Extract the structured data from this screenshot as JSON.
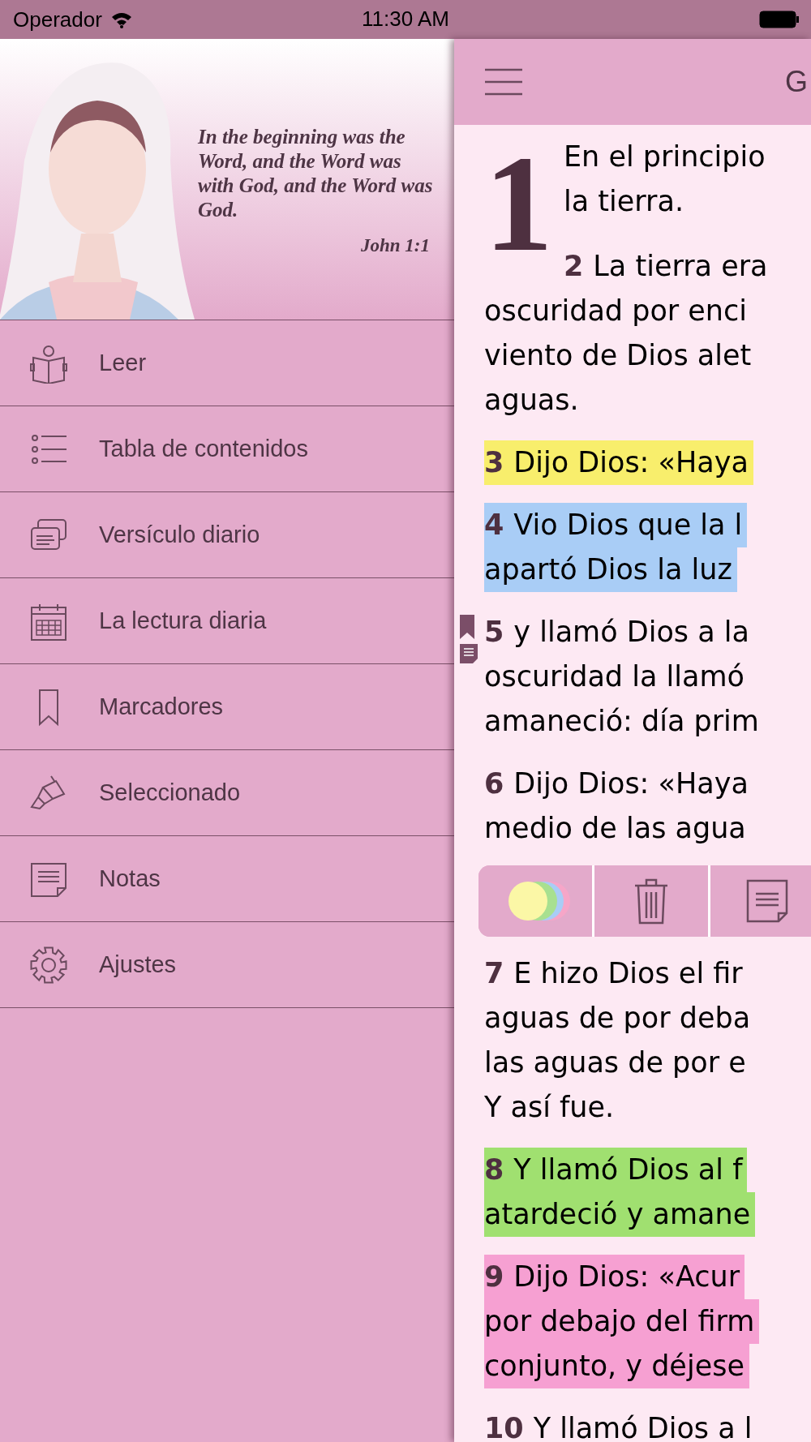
{
  "status_bar": {
    "carrier": "Operador",
    "time": "11:30 AM"
  },
  "drawer": {
    "header": {
      "kind": "picture",
      "quote": "In the beginning was the Word, and the Word was with God, and the Word was God.",
      "reference": "John 1:1"
    },
    "items": [
      {
        "kind": "read",
        "label": "Leer"
      },
      {
        "kind": "list",
        "label": "Tabla de contenidos"
      },
      {
        "kind": "cards",
        "label": "Versículo diario"
      },
      {
        "kind": "calendar",
        "label": "La lectura diaria"
      },
      {
        "kind": "bookmark",
        "label": "Marcadores"
      },
      {
        "kind": "highlighter",
        "label": "Seleccionado"
      },
      {
        "kind": "note",
        "label": "Notas"
      },
      {
        "kind": "gear",
        "label": "Ajustes"
      }
    ]
  },
  "reader": {
    "title": "G",
    "chapter": {
      "number": "1",
      "lines": [
        "En el principio",
        "la tierra."
      ]
    },
    "verses": [
      {
        "number": "2",
        "lines": [
          "La tierra era",
          "oscuridad por enci",
          "viento de Dios alet",
          "aguas."
        ],
        "bookmarked": false,
        "noted": false
      },
      {
        "number": "3",
        "lines": [
          "Dijo Dios: «Haya"
        ],
        "color": "#f8ee6c",
        "bookmarked": false,
        "noted": false
      },
      {
        "number": "4",
        "lines": [
          "Vio Dios que la l",
          "apartó Dios la luz"
        ],
        "color": "#a9cdf6",
        "bookmarked": false,
        "noted": false
      },
      {
        "number": "5",
        "lines": [
          "y llamó Dios a la",
          "oscuridad la llamó",
          "amaneció: día prim"
        ],
        "bookmarked": true,
        "noted": true
      },
      {
        "number": "6",
        "lines": [
          "Dijo Dios: «Haya",
          "medio de las agua"
        ],
        "bookmarked": false,
        "noted": false,
        "action_bar": {
          "buttons": [
            {
              "kind": "colors"
            },
            {
              "kind": "delete"
            },
            {
              "kind": "note"
            }
          ]
        }
      },
      {
        "number": "7",
        "lines": [
          "E hizo Dios el fir",
          "aguas de por deba",
          "las aguas de por e",
          "Y así fue."
        ],
        "bookmarked": false,
        "noted": false
      },
      {
        "number": "8",
        "lines": [
          "Y llamó Dios al f",
          "atardeció y amane"
        ],
        "color": "#a0e070",
        "bookmarked": false,
        "noted": false
      },
      {
        "number": "9",
        "lines": [
          "Dijo Dios: «Acur",
          "por debajo del firm",
          "conjunto, y déjese"
        ],
        "color": "#f6a0d2",
        "bookmarked": false,
        "noted": false
      },
      {
        "number": "10",
        "lines": [
          "Y llamó Dios a l"
        ],
        "bookmarked": false,
        "noted": false
      }
    ]
  }
}
